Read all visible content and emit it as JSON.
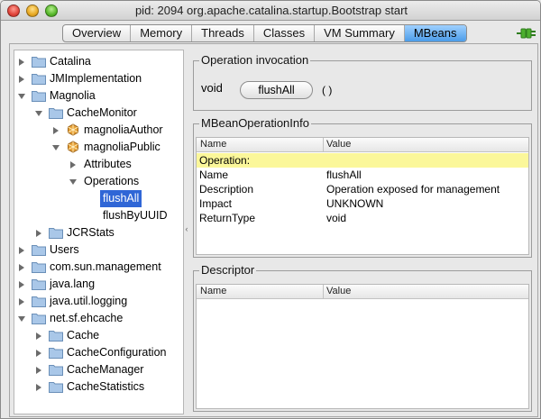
{
  "window": {
    "title": "pid: 2094 org.apache.catalina.startup.Bootstrap start"
  },
  "tabs": [
    {
      "label": "Overview",
      "active": false
    },
    {
      "label": "Memory",
      "active": false
    },
    {
      "label": "Threads",
      "active": false
    },
    {
      "label": "Classes",
      "active": false
    },
    {
      "label": "VM Summary",
      "active": false
    },
    {
      "label": "MBeans",
      "active": true
    }
  ],
  "tree": {
    "items": [
      {
        "label": "Catalina",
        "type": "folder",
        "expanded": false
      },
      {
        "label": "JMImplementation",
        "type": "folder",
        "expanded": false
      },
      {
        "label": "Magnolia",
        "type": "folder",
        "expanded": true
      },
      {
        "label": "CacheMonitor",
        "type": "folder",
        "expanded": true
      },
      {
        "label": "magnoliaAuthor",
        "type": "bean",
        "expanded": false
      },
      {
        "label": "magnoliaPublic",
        "type": "bean",
        "expanded": true
      },
      {
        "label": "Attributes",
        "type": "node",
        "expanded": false
      },
      {
        "label": "Operations",
        "type": "node",
        "expanded": true
      },
      {
        "label": "flushAll",
        "type": "leaf",
        "selected": true
      },
      {
        "label": "flushByUUID",
        "type": "leaf",
        "selected": false
      },
      {
        "label": "JCRStats",
        "type": "folder",
        "expanded": false
      },
      {
        "label": "Users",
        "type": "folder",
        "expanded": false
      },
      {
        "label": "com.sun.management",
        "type": "folder",
        "expanded": false
      },
      {
        "label": "java.lang",
        "type": "folder",
        "expanded": false
      },
      {
        "label": "java.util.logging",
        "type": "folder",
        "expanded": false
      },
      {
        "label": "net.sf.ehcache",
        "type": "folder",
        "expanded": true
      },
      {
        "label": "Cache",
        "type": "folder",
        "expanded": false
      },
      {
        "label": "CacheConfiguration",
        "type": "folder",
        "expanded": false
      },
      {
        "label": "CacheManager",
        "type": "folder",
        "expanded": false
      },
      {
        "label": "CacheStatistics",
        "type": "folder",
        "expanded": false
      }
    ]
  },
  "invocation": {
    "group_title": "Operation invocation",
    "return_type": "void",
    "button_label": "flushAll",
    "params": "( )"
  },
  "info": {
    "group_title": "MBeanOperationInfo",
    "col_name": "Name",
    "col_value": "Value",
    "section_label": "Operation:",
    "rows": [
      {
        "name": "Name",
        "value": "flushAll"
      },
      {
        "name": "Description",
        "value": "Operation exposed for management"
      },
      {
        "name": "Impact",
        "value": "UNKNOWN"
      },
      {
        "name": "ReturnType",
        "value": "void"
      }
    ]
  },
  "descriptor": {
    "group_title": "Descriptor",
    "col_name": "Name",
    "col_value": "Value"
  },
  "colors": {
    "selection": "#2f66d6",
    "active_tab": "#4c9ce8",
    "highlight_row": "#fbf79a"
  }
}
